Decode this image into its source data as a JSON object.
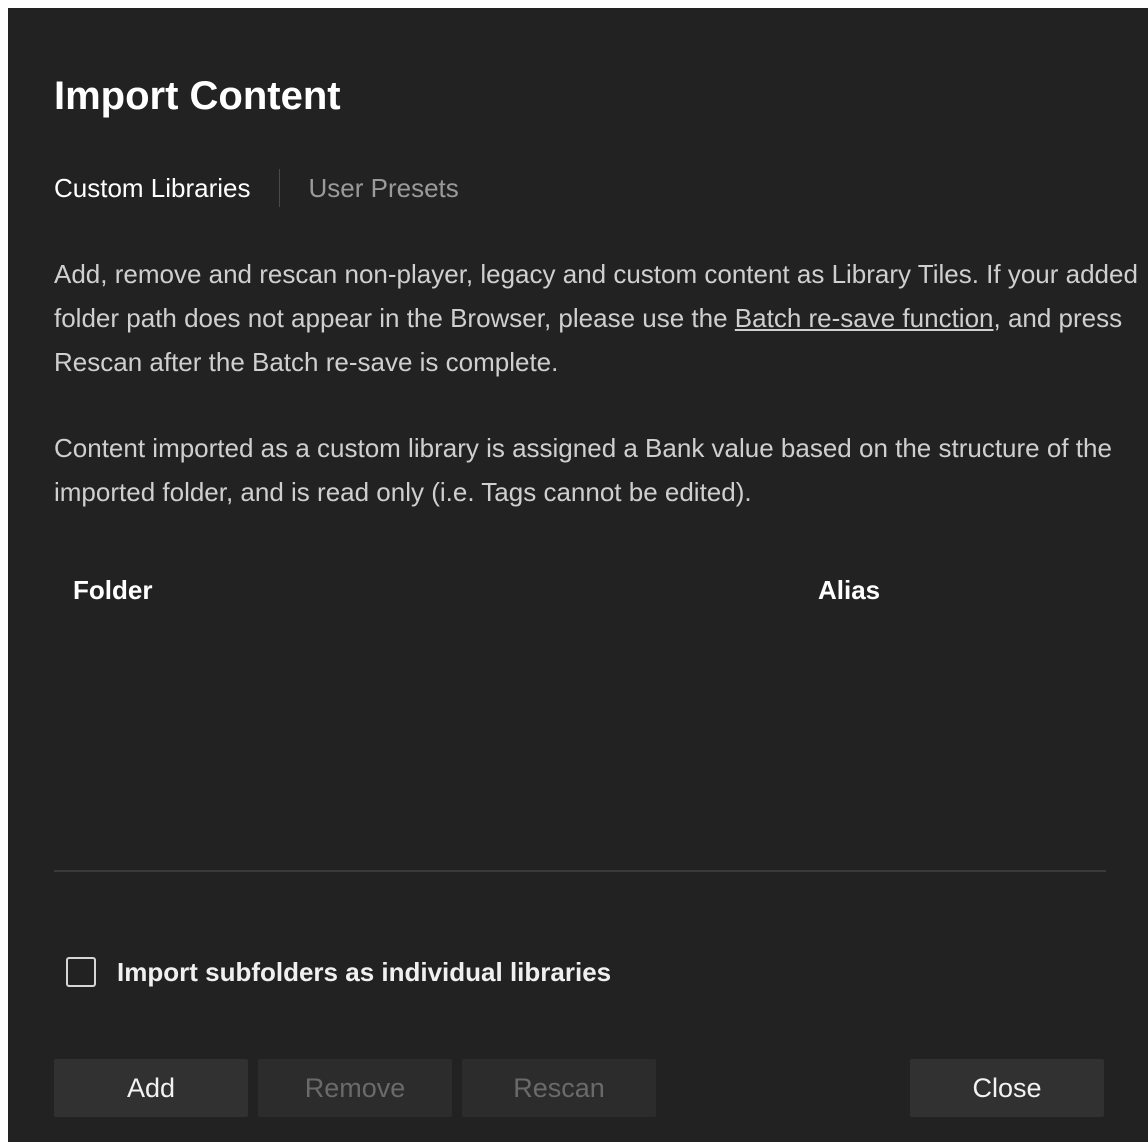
{
  "dialog": {
    "title": "Import Content"
  },
  "tabs": [
    {
      "label": "Custom Libraries",
      "active": true
    },
    {
      "label": "User Presets",
      "active": false
    }
  ],
  "description": {
    "paragraph1_before_link": "Add, remove and rescan non-player, legacy and custom content as Library Tiles. If your added folder path does not appear in the Browser, please use the ",
    "paragraph1_link": "Batch re-save function",
    "paragraph1_after_link": ", and press Rescan after the Batch re-save is complete.",
    "paragraph2": "Content imported as a custom library is assigned a Bank value based on the structure of the imported folder, and is read only (i.e. Tags cannot be edited)."
  },
  "table": {
    "columns": [
      "Folder",
      "Alias"
    ],
    "rows": []
  },
  "options": {
    "import_subfolders_label": "Import subfolders as individual libraries",
    "import_subfolders_checked": false
  },
  "buttons": {
    "add": "Add",
    "remove": "Remove",
    "rescan": "Rescan",
    "close": "Close"
  },
  "colors": {
    "background": "#222222",
    "button": "#313131",
    "text_primary": "#ffffff",
    "text_muted": "#9a9a9a",
    "text_disabled": "#6a6a6a"
  }
}
